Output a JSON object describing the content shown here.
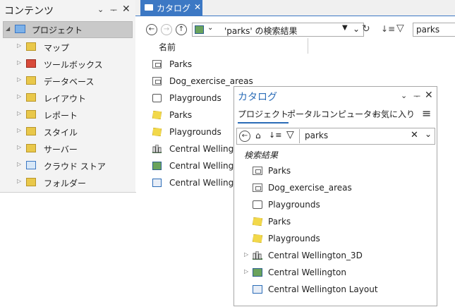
{
  "contents": {
    "title": "コンテンツ",
    "header_icons": [
      "chevron-down-icon",
      "pin-icon",
      "close-icon"
    ],
    "project_label": "プロジェクト",
    "items": [
      {
        "label": "マップ",
        "icon": "map-folder-icon"
      },
      {
        "label": "ツールボックス",
        "icon": "toolbox-icon"
      },
      {
        "label": "データベース",
        "icon": "database-icon"
      },
      {
        "label": "レイアウト",
        "icon": "layout-folder-icon"
      },
      {
        "label": "レポート",
        "icon": "report-icon"
      },
      {
        "label": "スタイル",
        "icon": "style-icon"
      },
      {
        "label": "サーバー",
        "icon": "server-icon"
      },
      {
        "label": "クラウド ストア",
        "icon": "cloud-store-icon"
      },
      {
        "label": "フォルダー",
        "icon": "folder-icon"
      }
    ]
  },
  "catalog_view": {
    "tab_label": "カタログ",
    "location_text": "'parks' の検索結果",
    "search_value": "parks",
    "column_header": "名前",
    "items": [
      {
        "label": "Parks",
        "icon": "table-icon"
      },
      {
        "label": "Dog_exercise_areas",
        "icon": "table-icon"
      },
      {
        "label": "Playgrounds",
        "icon": "point-layer-icon"
      },
      {
        "label": "Parks",
        "icon": "polygon-layer-icon"
      },
      {
        "label": "Playgrounds",
        "icon": "polygon-layer-icon"
      },
      {
        "label": "Central Wellington",
        "icon": "scene-icon"
      },
      {
        "label": "Central Wellington",
        "icon": "map-icon"
      },
      {
        "label": "Central Wellington",
        "icon": "layout-icon"
      }
    ]
  },
  "catalog_pane": {
    "title": "カタログ",
    "tabs": [
      "プロジェクト",
      "ポータル",
      "コンピューター",
      "お気に入り"
    ],
    "active_tab": "プロジェクト",
    "search_value": "parks",
    "section_label": "検索結果",
    "items": [
      {
        "label": "Parks",
        "icon": "table-icon",
        "expandable": false
      },
      {
        "label": "Dog_exercise_areas",
        "icon": "table-icon",
        "expandable": false
      },
      {
        "label": "Playgrounds",
        "icon": "point-layer-icon",
        "expandable": false
      },
      {
        "label": "Parks",
        "icon": "polygon-layer-icon",
        "expandable": false
      },
      {
        "label": "Playgrounds",
        "icon": "polygon-layer-icon",
        "expandable": false
      },
      {
        "label": "Central Wellington_3D",
        "icon": "scene-icon",
        "expandable": true
      },
      {
        "label": "Central Wellington",
        "icon": "map-icon",
        "expandable": true
      },
      {
        "label": "Central Wellington Layout",
        "icon": "layout-icon",
        "expandable": false
      }
    ]
  },
  "colors": {
    "accent": "#3c78c4",
    "title_blue": "#2b6cb7",
    "selection": "#c9c9c9"
  }
}
